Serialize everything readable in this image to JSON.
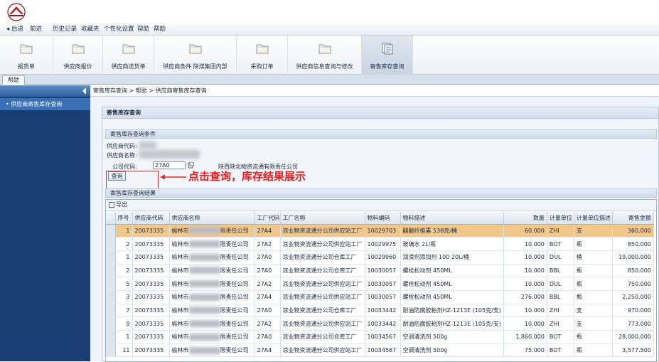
{
  "menu": {
    "items": [
      "◂ 后退",
      "前进",
      "历史记录",
      "收藏夹",
      "个性化设置",
      "帮助",
      "帮助"
    ]
  },
  "toolbar": {
    "items": [
      {
        "label": "报货单"
      },
      {
        "label": "供应商报价"
      },
      {
        "label": "供应商送货单"
      },
      {
        "label": "供应商条件 陕煤集团内部"
      },
      {
        "label": "采购订单"
      },
      {
        "label": "供应商信息查询与修改"
      },
      {
        "label": "寄售库存查询"
      }
    ]
  },
  "tab": {
    "label": "帮助"
  },
  "leftnav": {
    "item": "供应商寄售库存查询"
  },
  "breadcrumb": "寄售库存查询 > 帮助 > 供应商寄售库存查询",
  "panel": {
    "title": "寄售库存查询",
    "condition_title": "寄售库存查询条件",
    "supplier_code_label": "供应商代码:",
    "supplier_name_label": "供应商名称:",
    "company_code_label": "公司代码:",
    "company_code_value": "27A0",
    "company_name": "陕西陕北物资流通有限责任公司",
    "query_button": "查询",
    "result_title": "寄售库存查询结果",
    "export_label": "导出",
    "annotation": "点击查询，库存结果展示"
  },
  "table": {
    "columns": [
      "序号",
      "供应商代码",
      "供应商名称",
      "工厂代码",
      "工厂名称",
      "物料编码",
      "物料描述",
      "数量",
      "计量单位",
      "计量单位描述",
      "寄售金额"
    ],
    "rows": [
      {
        "no": "1",
        "code": "20073335",
        "name_prefix": "榆林市",
        "name_suffix": "限责任公司",
        "plant": "27A4",
        "plant_name": "凉业物资流通分公司供应站工厂",
        "mat": "10029703",
        "desc": "醋酸纤维素 538克/桶",
        "qty": "60.000",
        "unit": "ZHI",
        "unit_desc": "支",
        "amount": "360.000"
      },
      {
        "no": "2",
        "code": "20073335",
        "name_prefix": "榆林市",
        "name_suffix": "限责任公司",
        "plant": "27A2",
        "plant_name": "凉业物资流通分公司供应站工厂",
        "mat": "10029975",
        "desc": "玻璃水 2L/瓶",
        "qty": "10.000",
        "unit": "BOT",
        "unit_desc": "瓶",
        "amount": "850.000"
      },
      {
        "no": "1",
        "code": "20073335",
        "name_prefix": "榆林市",
        "name_suffix": "限责任公司",
        "plant": "27A0",
        "plant_name": "凉业物资流通分公司仓库工厂",
        "mat": "10029960",
        "desc": "润滑剂添加剂 100 20L/桶",
        "qty": "10.000",
        "unit": "DUL",
        "unit_desc": "桶",
        "amount": "19,000.000"
      },
      {
        "no": "2",
        "code": "20073335",
        "name_prefix": "榆林市",
        "name_suffix": "限责任公司",
        "plant": "27A0",
        "plant_name": "凉业物资流通分公司仓库工厂",
        "mat": "10030057",
        "desc": "螺栓松动剂 450ML",
        "qty": "10.000",
        "unit": "BBL",
        "unit_desc": "瓶",
        "amount": "850.000"
      },
      {
        "no": "5",
        "code": "20073335",
        "name_prefix": "榆林市",
        "name_suffix": "限责任公司",
        "plant": "27A2",
        "plant_name": "凉业物资流通分公司供应站工厂",
        "mat": "10030057",
        "desc": "螺栓松动剂 450ML",
        "qty": "10.000",
        "unit": "DUL",
        "unit_desc": "瓶",
        "amount": "750.000"
      },
      {
        "no": "3",
        "code": "20073335",
        "name_prefix": "榆林市",
        "name_suffix": "限责任公司",
        "plant": "27A4",
        "plant_name": "凉业物资流通分公司供应站工厂",
        "mat": "10030057",
        "desc": "螺栓松动剂 450ML",
        "qty": "276.000",
        "unit": "BBL",
        "unit_desc": "瓶",
        "amount": "2,250.000"
      },
      {
        "no": "7",
        "code": "20073335",
        "name_prefix": "榆林市",
        "name_suffix": "限责任公司",
        "plant": "27A0",
        "plant_name": "凉业物资流通分公司仓库工厂",
        "mat": "10033442",
        "desc": "耐油防腐胶粘剂HZ-1213E (105克/支)",
        "qty": "10.000",
        "unit": "ZHI",
        "unit_desc": "支",
        "amount": "970.000"
      },
      {
        "no": "9",
        "code": "20073335",
        "name_prefix": "榆林市",
        "name_suffix": "限责任公司",
        "plant": "27A2",
        "plant_name": "凉业物资流通分公司供应站工厂",
        "mat": "10033442",
        "desc": "耐油防腐胶粘剂HZ-1213E (105克/支)",
        "qty": "10.000",
        "unit": "ZHI",
        "unit_desc": "支",
        "amount": "773.000"
      },
      {
        "no": "1",
        "code": "20073335",
        "name_prefix": "榆林市",
        "name_suffix": "限责任公司",
        "plant": "27A0",
        "plant_name": "凉业物资流通分公司仓库工厂",
        "mat": "10034567",
        "desc": "空调清洗剂 500g",
        "qty": "1,860.000",
        "unit": "BOT",
        "unit_desc": "瓶",
        "amount": "28,000.000"
      },
      {
        "no": "11",
        "code": "20073335",
        "name_prefix": "榆林市",
        "name_suffix": "限责任公司",
        "plant": "27A4",
        "plant_name": "凉业物资流通分公司供应站工厂",
        "mat": "10034567",
        "desc": "空调清洗剂 500g",
        "qty": "75.000",
        "unit": "BOT",
        "unit_desc": "瓶",
        "amount": "3,577.500"
      }
    ]
  }
}
